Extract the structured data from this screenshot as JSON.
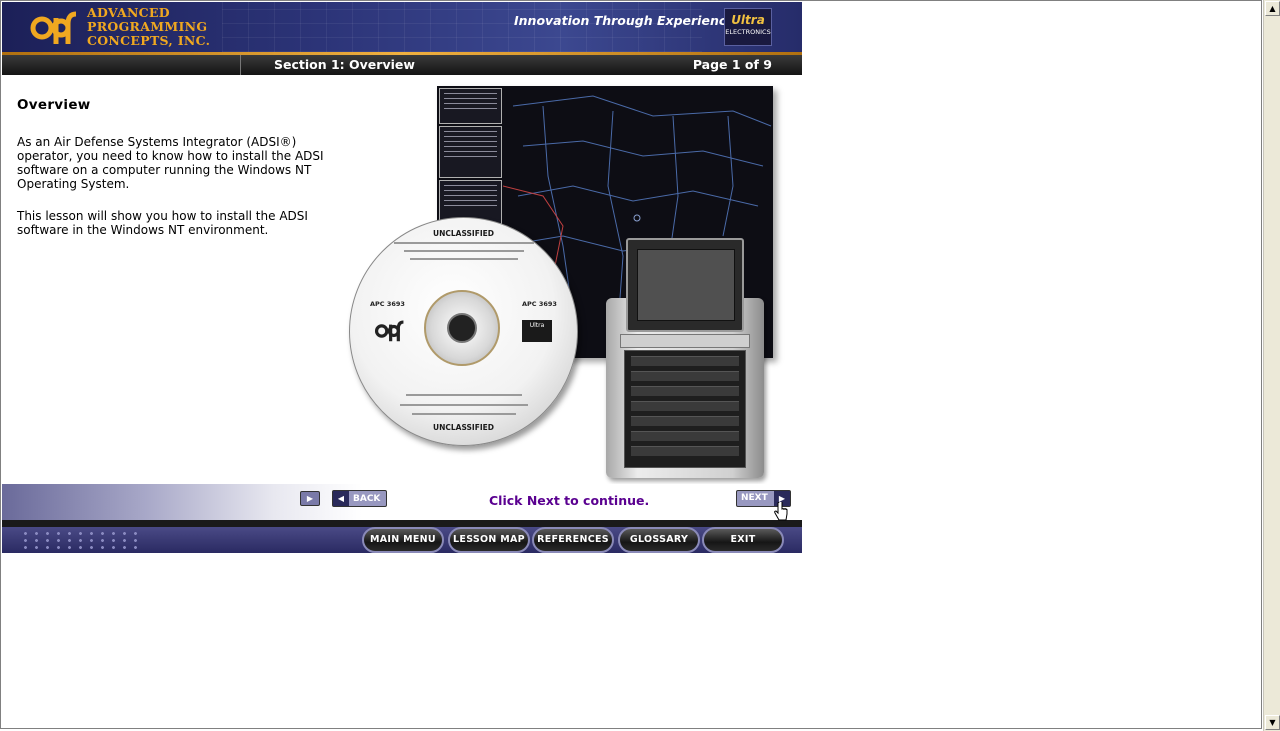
{
  "header": {
    "company_line1": "ADVANCED",
    "company_line2": "PROGRAMMING",
    "company_line3": "CONCEPTS, INC.",
    "tagline": "Innovation Through Experience",
    "partner_line1": "Ultra",
    "partner_line2": "ELECTRONICS"
  },
  "section_bar": {
    "title": "Section 1: Overview",
    "page": "Page 1 of 9"
  },
  "content": {
    "heading": "Overview",
    "paragraph1": "As an Air Defense Systems Integrator (ADSI®) operator, you need to know how to install the ADSI software on a computer running the Windows NT Operating System.",
    "paragraph2": "This lesson will show you how to install the ADSI software in the Windows NT environment."
  },
  "cd": {
    "top_label": "UNCLASSIFIED",
    "bottom_label": "UNCLASSIFIED",
    "left_code": "APC 3693",
    "right_code": "APC 3693",
    "logo_text": "Ultra"
  },
  "nav": {
    "back_label": "BACK",
    "prompt": "Click Next to continue.",
    "next_label": "NEXT"
  },
  "menu": {
    "main_menu": "MAIN MENU",
    "lesson_map": "LESSON MAP",
    "references": "REFERENCES",
    "glossary": "GLOSSARY",
    "exit": "EXIT"
  },
  "colors": {
    "header_bg": "#2c3478",
    "brand_gold": "#f0a820",
    "prompt": "#5a0090",
    "bottom_bar": "#3a3a76"
  }
}
